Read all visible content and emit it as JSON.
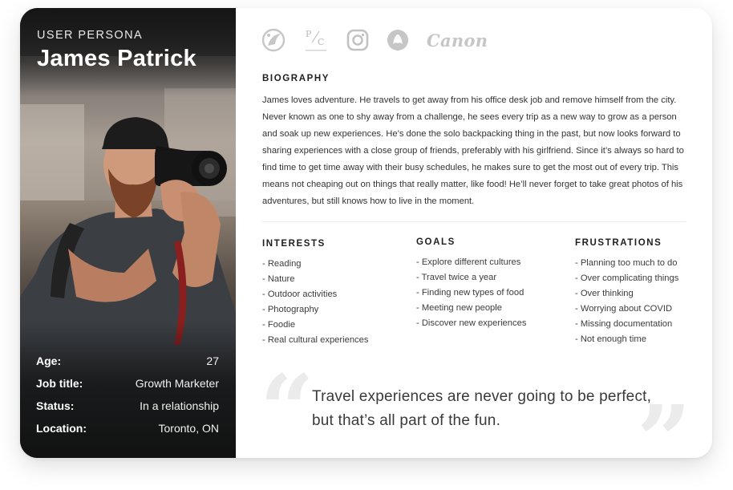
{
  "persona": {
    "label": "USER PERSONA",
    "name": "James Patrick",
    "stats": [
      {
        "key": "Age:",
        "value": "27"
      },
      {
        "key": "Job title:",
        "value": "Growth Marketer"
      },
      {
        "key": "Status:",
        "value": "In a relationship"
      },
      {
        "key": "Location:",
        "value": "Toronto, ON"
      }
    ]
  },
  "brands": [
    {
      "name": "raptors-logo-icon"
    },
    {
      "name": "pc-logo-icon",
      "text": "P/C"
    },
    {
      "name": "instagram-logo-icon"
    },
    {
      "name": "lululemon-logo-icon"
    },
    {
      "name": "canon-logo",
      "text": "Canon"
    }
  ],
  "biography": {
    "title": "BIOGRAPHY",
    "text": "James loves adventure. He travels to get away from his office desk job and remove himself from the city. Never known as one to shy away from a challenge, he sees every trip as a new way to grow as a person and soak up new experiences. He’s done the solo backpacking thing in the past, but now looks forward to sharing experiences with a close group of friends, preferably with his girlfriend. Since it’s always so hard to find time to get time away with their busy schedules, he makes sure to get the most out of every trip. This means not cheaping out on things that really matter, like food! He’ll never forget to take great photos of his adventures, but still knows how to live in the moment."
  },
  "interests": {
    "title": "INTERESTS",
    "items": [
      "- Reading",
      "- Nature",
      "- Outdoor activities",
      "- Photography",
      "- Foodie",
      "- Real cultural experiences"
    ]
  },
  "goals": {
    "title": "GOALS",
    "items": [
      "- Explore different cultures",
      "- Travel twice a year",
      "- Finding new types of food",
      "- Meeting new people",
      "- Discover new experiences"
    ]
  },
  "frustrations": {
    "title": "FRUSTRATIONS",
    "items": [
      "- Planning too much to do",
      "- Over complicating things",
      "- Over thinking",
      "- Worrying about COVID",
      "- Missing documentation",
      "- Not enough time"
    ]
  },
  "quote": {
    "text": "Travel experiences are never going to be perfect, but that’s all part of the fun."
  },
  "colors": {
    "accent_text": "#1f1f1f",
    "muted_logo": "#c4c4c4",
    "quote_mark": "#ebebeb"
  }
}
